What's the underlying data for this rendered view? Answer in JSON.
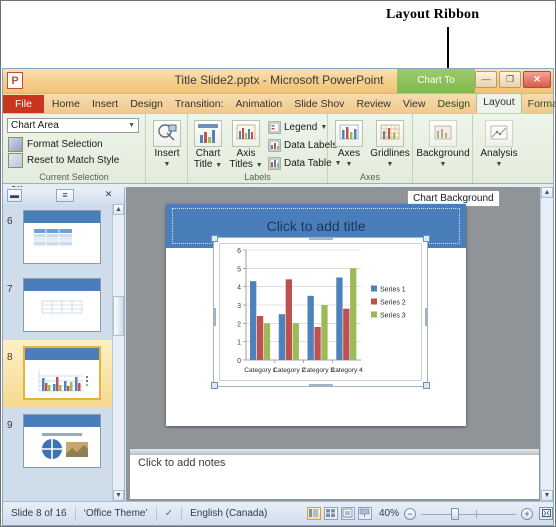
{
  "callout": {
    "label": "Layout Ribbon"
  },
  "window": {
    "title": "Title Slide2.pptx  -  Microsoft PowerPoint",
    "logo": "P",
    "contextual_tab": "Chart To",
    "buttons": {
      "minimize": "—",
      "restore": "❐",
      "close": "✕"
    }
  },
  "tabs": {
    "file": "File",
    "items": [
      "Home",
      "Insert",
      "Design",
      "Transition:",
      "Animation",
      "Slide Shov",
      "Review",
      "View"
    ],
    "chart_tools": [
      "Design",
      "Layout",
      "Format"
    ],
    "active": "Layout",
    "help": "?"
  },
  "ribbon": {
    "groups": [
      {
        "name": "Current Selection",
        "title": "Current Selection"
      },
      {
        "name": "Insert",
        "title": ""
      },
      {
        "name": "Labels",
        "title": "Labels"
      },
      {
        "name": "Axes",
        "title": "Axes"
      },
      {
        "name": "Background",
        "title": ""
      },
      {
        "name": "Analysis",
        "title": ""
      }
    ],
    "current_selection": {
      "combo_value": "Chart Area",
      "format_selection": "Format Selection",
      "reset_to_match_style": "Reset to Match Style",
      "group_title": "Current Selection"
    },
    "insert": {
      "label": "Insert"
    },
    "labels": {
      "group_title": "Labels",
      "chart_title": "Chart\nTitle",
      "chart_title_line1": "Chart",
      "chart_title_line2": "Title",
      "axis_titles_line1": "Axis",
      "axis_titles_line2": "Titles",
      "legend": "Legend",
      "data_labels": "Data Labels",
      "data_table": "Data Table"
    },
    "axes": {
      "group_title": "Axes",
      "axes": "Axes",
      "gridlines": "Gridlines"
    },
    "background": {
      "label": "Background"
    },
    "analysis": {
      "label": "Analysis"
    }
  },
  "quick_access": {
    "save": "save-icon",
    "undo": "undo-icon",
    "redo": "redo-icon",
    "customize": "customize-icon"
  },
  "slide_panel": {
    "collapse": "▬",
    "outline": "≡",
    "close": "✕",
    "thumbnails": [
      {
        "number": "6",
        "type": "table"
      },
      {
        "number": "7",
        "type": "table"
      },
      {
        "number": "8",
        "type": "chart",
        "selected": true
      },
      {
        "number": "9",
        "type": "diagram"
      }
    ]
  },
  "slide": {
    "title_placeholder": "Click to add title",
    "tooltip": "Chart Background",
    "notes_placeholder": "Click to add notes"
  },
  "status": {
    "slide_counter": "Slide 8 of 16",
    "theme": "‘Office Theme’",
    "spellcheck": "spellcheck-icon",
    "language": "English (Canada)",
    "zoom": "40%",
    "zoom_out": "−",
    "zoom_in": "+",
    "fit": "fit-icon",
    "views": [
      "Normal",
      "Slide Sorter",
      "Reading View",
      "Slide Show"
    ]
  },
  "chart_data": {
    "type": "bar",
    "title": "",
    "categories": [
      "Category 1",
      "Category 2",
      "Category 3",
      "Category 4"
    ],
    "series": [
      {
        "name": "Series 1",
        "color": "#4f81bd",
        "values": [
          4.3,
          2.5,
          3.5,
          4.5
        ]
      },
      {
        "name": "Series 2",
        "color": "#c0504d",
        "values": [
          2.4,
          4.4,
          1.8,
          2.8
        ]
      },
      {
        "name": "Series 3",
        "color": "#9bbb59",
        "values": [
          2.0,
          2.0,
          3.0,
          5.0
        ]
      }
    ],
    "ylim": [
      0,
      6
    ],
    "yticks": [
      0,
      1,
      2,
      3,
      4,
      5,
      6
    ],
    "xlabel": "",
    "ylabel": "",
    "grid": true,
    "legend_position": "right"
  }
}
